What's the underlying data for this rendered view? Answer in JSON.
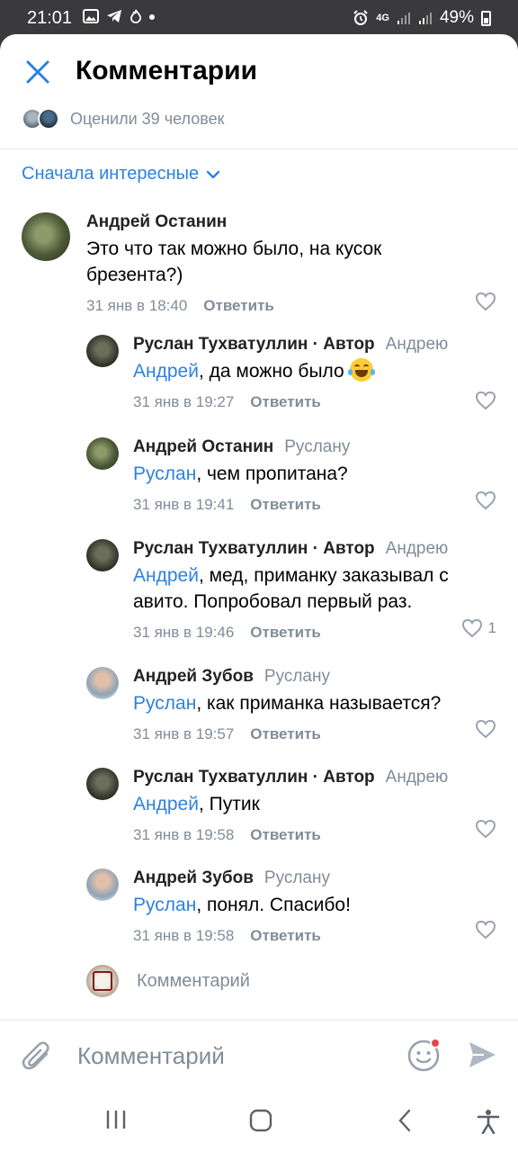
{
  "status_bar": {
    "time": "21:01",
    "network": "4G",
    "battery": "49%"
  },
  "header": {
    "title": "Комментарии",
    "liked_by": "Оценили 39 человек"
  },
  "sort": {
    "label": "Сначала интересные"
  },
  "colors": {
    "accent": "#2d81e0",
    "secondary_text": "#818c99"
  },
  "comments": [
    {
      "author": "Андрей Останин",
      "reply_to": "",
      "mention": "",
      "text": "Это что так можно было, на кусок брезента?)",
      "date": "31 янв в 18:40",
      "reply_label": "Ответить",
      "likes": ""
    },
    {
      "author": "Руслан Тухватуллин · Автор",
      "reply_to": "Андрею",
      "mention": "Андрей",
      "text": ", да можно было ",
      "emoji": "tears-of-joy",
      "date": "31 янв в 19:27",
      "reply_label": "Ответить",
      "likes": ""
    },
    {
      "author": "Андрей Останин",
      "reply_to": "Руслану",
      "mention": "Руслан",
      "text": ", чем пропитана?",
      "date": "31 янв в 19:41",
      "reply_label": "Ответить",
      "likes": ""
    },
    {
      "author": "Руслан Тухватуллин · Автор",
      "reply_to": "Андрею",
      "mention": "Андрей",
      "text": ", мед, приманку заказывал с авито. Попробовал первый раз.",
      "date": "31 янв в 19:46",
      "reply_label": "Ответить",
      "likes": "1"
    },
    {
      "author": "Андрей Зубов",
      "reply_to": "Руслану",
      "mention": "Руслан",
      "text": ", как приманка называется?",
      "date": "31 янв в 19:57",
      "reply_label": "Ответить",
      "likes": ""
    },
    {
      "author": "Руслан Тухватуллин · Автор",
      "reply_to": "Андрею",
      "mention": "Андрей",
      "text": ", Путик",
      "date": "31 янв в 19:58",
      "reply_label": "Ответить",
      "likes": ""
    },
    {
      "author": "Андрей Зубов",
      "reply_to": "Руслану",
      "mention": "Руслан",
      "text": ", понял. Спасибо!",
      "date": "31 янв в 19:58",
      "reply_label": "Ответить",
      "likes": ""
    }
  ],
  "reply_compose": {
    "placeholder": "Комментарий"
  },
  "compose_bar": {
    "placeholder": "Комментарий"
  }
}
